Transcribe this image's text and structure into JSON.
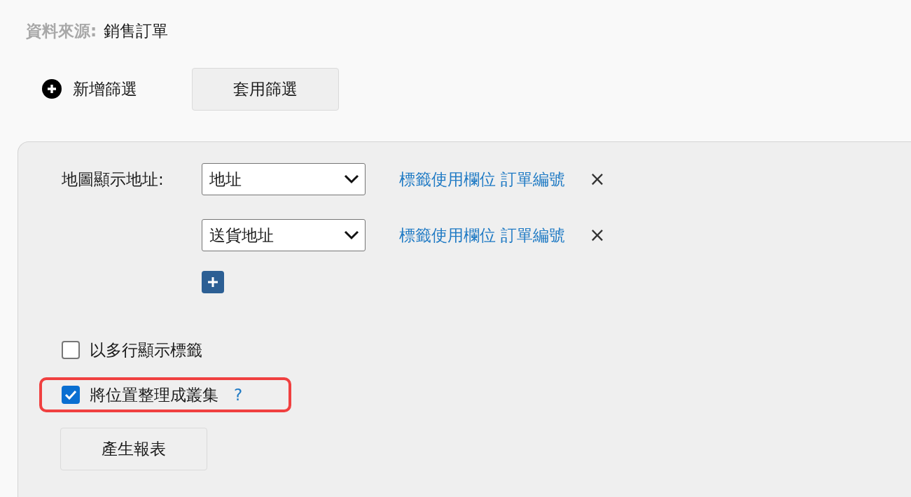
{
  "data_source": {
    "label": "資料來源:",
    "value": "銷售訂單"
  },
  "add_filter": {
    "label": "新增篩選"
  },
  "apply_filter_button": "套用篩選",
  "map_address": {
    "label": "地圖顯示地址:",
    "rows": [
      {
        "value": "地址",
        "link": "標籤使用欄位 訂單編號",
        "remove": "×"
      },
      {
        "value": "送貨地址",
        "link": "標籤使用欄位 訂單編號",
        "remove": "×"
      }
    ]
  },
  "options": [
    {
      "label": "以多行顯示標籤",
      "checked": false,
      "highlighted": false
    },
    {
      "label": "將位置整理成叢集",
      "checked": true,
      "highlighted": true,
      "help": "?"
    }
  ],
  "generate_button": "產生報表"
}
